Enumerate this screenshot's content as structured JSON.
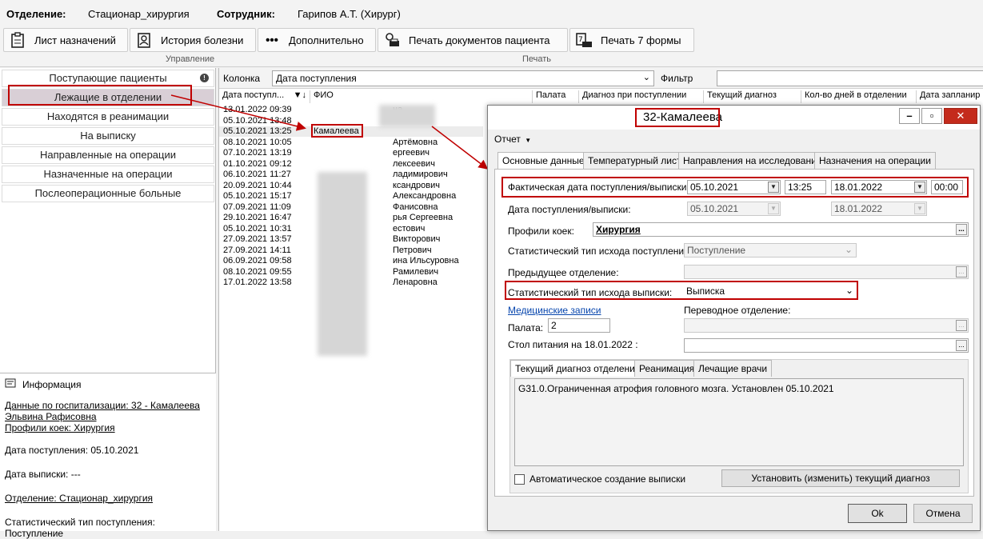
{
  "topbar": {
    "dept_label": "Отделение:",
    "dept_value": "Стационар_хирургия",
    "staff_label": "Сотрудник:",
    "staff_value": "Гарипов А.Т. (Хирург)"
  },
  "ribbon": {
    "btn_orders": "Лист назначений",
    "btn_history": "История болезни",
    "btn_more": "Дополнительно",
    "btn_print_docs": "Печать документов пациента",
    "btn_print7": "Печать 7 формы",
    "group_manage": "Управление",
    "group_print": "Печать"
  },
  "nav": {
    "items": [
      "Поступающие пациенты",
      "Лежащие в отделении",
      "Находятся в реанимации",
      "На выписку",
      "Направленные на операции",
      "Назначенные на операции",
      "Послеоперационные больные"
    ]
  },
  "info": {
    "title": "Информация",
    "hosp_line1": "Данные по госпитализации: 32 - Камалеева",
    "hosp_line2": "Эльвина Рафисовна",
    "profile": "Профили коек: Хирургия",
    "admit_date": "Дата поступления: 05.10.2021",
    "discharge_date": "Дата выписки: ---",
    "department": "Отделение: Стационар_хирургия",
    "stat_type": "Статистический тип поступления:",
    "stat_value": "Поступление"
  },
  "grid": {
    "column_label": "Колонка",
    "column_value": "Дата поступления",
    "filter_label": "Фильтр",
    "headers": [
      "Дата поступл...",
      "ФИО",
      "Палата",
      "Диагноз при поступлении",
      "Текущий диагноз",
      "Кол-во дней в отделении",
      "Дата запланир"
    ],
    "rows": [
      {
        "date": "13.01.2022 09:39",
        "name": "",
        "tail": "на"
      },
      {
        "date": "05.10.2021 13:48",
        "name": "",
        "tail": ""
      },
      {
        "date": "05.10.2021 13:25",
        "name": "Камалеева",
        "tail": ""
      },
      {
        "date": "08.10.2021 10:05",
        "name": "",
        "tail": "Артёмовна"
      },
      {
        "date": "07.10.2021 13:19",
        "name": "",
        "tail": "ергеевич"
      },
      {
        "date": "01.10.2021 09:12",
        "name": "",
        "tail": "лексеевич"
      },
      {
        "date": "06.10.2021 11:27",
        "name": "",
        "tail": "ладимирович"
      },
      {
        "date": "20.09.2021 10:44",
        "name": "",
        "tail": "ксандрович"
      },
      {
        "date": "05.10.2021 15:17",
        "name": "",
        "tail": "Александровна"
      },
      {
        "date": "07.09.2021 11:09",
        "name": "",
        "tail": "Фанисовна"
      },
      {
        "date": "29.10.2021 16:47",
        "name": "",
        "tail": "рья Сергеевна"
      },
      {
        "date": "05.10.2021 10:31",
        "name": "",
        "tail": "естович"
      },
      {
        "date": "27.09.2021 13:57",
        "name": "",
        "tail": "Викторович"
      },
      {
        "date": "27.09.2021 14:11",
        "name": "",
        "tail": "Петрович"
      },
      {
        "date": "06.09.2021 09:58",
        "name": "",
        "tail": "ина Ильсуровна"
      },
      {
        "date": "08.10.2021 09:55",
        "name": "",
        "tail": "Рамилевич"
      },
      {
        "date": "17.01.2022 13:58",
        "name": "",
        "tail": "Ленаровна"
      }
    ]
  },
  "dialog": {
    "title": "32-Камалеева",
    "report_menu": "Отчет",
    "tabs": [
      "Основные данные",
      "Температурный лист",
      "Направления на исследования",
      "Назначения на операции"
    ],
    "actual_dates_label": "Фактическая дата поступления/выписки:",
    "actual_admit": "05.10.2021",
    "actual_admit_time": "13:25",
    "actual_discharge": "18.01.2022",
    "actual_discharge_time": "00:00",
    "dates_label": "Дата поступления/выписки:",
    "admit": "05.10.2021",
    "discharge": "18.01.2022",
    "profile_label": "Профили коек:",
    "profile_value": "Хирургия",
    "stat_admit_label": "Статистический тип исхода поступления:",
    "stat_admit_value": "Поступление",
    "prev_dept_label": "Предыдущее отделение:",
    "stat_discharge_label": "Статистический тип исхода выписки:",
    "stat_discharge_value": "Выписка",
    "med_records_link": "Медицинские записи",
    "transfer_dept_label": "Переводное отделение:",
    "ward_label": "Палата:",
    "ward_value": "2",
    "diet_label": "Стол питания на 18.01.2022 :",
    "subtabs": [
      "Текущий диагноз отделения",
      "Реанимация",
      "Лечащие врачи"
    ],
    "diagnosis_text": "G31.0.Ограниченная атрофия головного мозга. Установлен 05.10.2021",
    "auto_discharge_label": "Автоматическое создание выписки",
    "set_diagnosis_button": "Установить (изменить) текущий диагноз",
    "ok_button": "Ok",
    "cancel_button": "Отмена"
  },
  "colors": {
    "highlight_red": "#c00000",
    "selected_nav": "#d9cfd6",
    "link_blue": "#0645ad"
  }
}
